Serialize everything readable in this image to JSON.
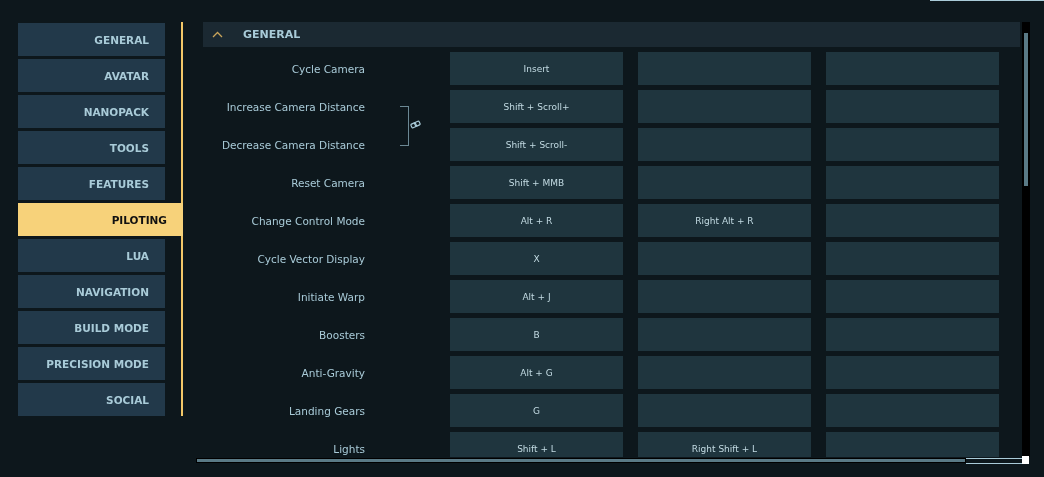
{
  "sidebar": {
    "items": [
      {
        "label": "GENERAL",
        "selected": false
      },
      {
        "label": "AVATAR",
        "selected": false
      },
      {
        "label": "NANOPACK",
        "selected": false
      },
      {
        "label": "TOOLS",
        "selected": false
      },
      {
        "label": "FEATURES",
        "selected": false
      },
      {
        "label": "PILOTING",
        "selected": true
      },
      {
        "label": "LUA",
        "selected": false
      },
      {
        "label": "NAVIGATION",
        "selected": false
      },
      {
        "label": "BUILD MODE",
        "selected": false
      },
      {
        "label": "PRECISION MODE",
        "selected": false
      },
      {
        "label": "SOCIAL",
        "selected": false
      }
    ]
  },
  "section": {
    "title": "GENERAL",
    "expanded": true,
    "rows": [
      {
        "label": "Cycle Camera",
        "primary": "Insert",
        "linked": false
      },
      {
        "label": "Increase Camera Distance",
        "primary": "Shift + Scroll+",
        "linked": true
      },
      {
        "label": "Decrease Camera Distance",
        "primary": "Shift + Scroll-",
        "linked": true
      },
      {
        "label": "Reset Camera",
        "primary": "Shift + MMB",
        "linked": false
      },
      {
        "label": "Change Control Mode",
        "primary": "Alt + R",
        "secondary": "Right Alt + R",
        "linked": false
      },
      {
        "label": "Cycle Vector Display",
        "primary": "X",
        "linked": false
      },
      {
        "label": "Initiate Warp",
        "primary": "Alt + J",
        "linked": false
      },
      {
        "label": "Boosters",
        "primary": "B",
        "linked": false
      },
      {
        "label": "Anti-Gravity",
        "primary": "Alt + G",
        "linked": false
      },
      {
        "label": "Landing Gears",
        "primary": "G",
        "linked": false
      },
      {
        "label": "Lights",
        "primary": "Shift + L",
        "secondary": "Right Shift + L",
        "linked": false
      }
    ]
  }
}
